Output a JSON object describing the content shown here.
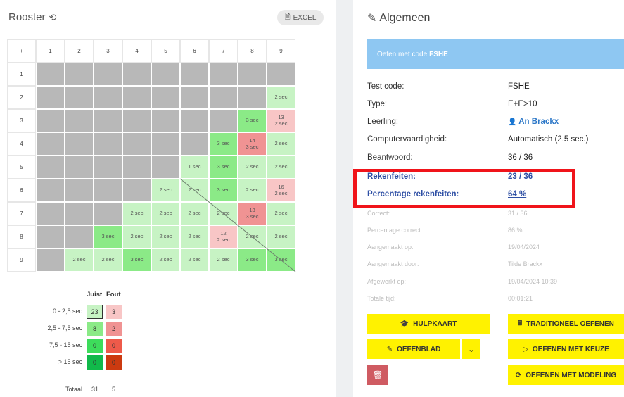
{
  "left": {
    "title": "Rooster",
    "excel_label": "EXCEL",
    "grid": {
      "corner": "+",
      "cols": [
        "1",
        "2",
        "3",
        "4",
        "5",
        "6",
        "7",
        "8",
        "9"
      ],
      "rows": [
        "1",
        "2",
        "3",
        "4",
        "5",
        "6",
        "7",
        "8",
        "9"
      ],
      "cells": [
        [
          "",
          "",
          "",
          "",
          "",
          "",
          "",
          "",
          ""
        ],
        [
          "",
          "",
          "",
          "",
          "",
          "",
          "",
          "",
          "2 sec"
        ],
        [
          "",
          "",
          "",
          "",
          "",
          "",
          "",
          "3 sec",
          "13\n2 sec"
        ],
        [
          "",
          "",
          "",
          "",
          "",
          "",
          "3 sec",
          "14\n3 sec",
          "2 sec"
        ],
        [
          "",
          "",
          "",
          "",
          "",
          "1 sec",
          "3 sec",
          "2 sec",
          "2 sec"
        ],
        [
          "",
          "",
          "",
          "",
          "2 sec",
          "2 sec",
          "3 sec",
          "2 sec",
          "16\n2 sec"
        ],
        [
          "",
          "",
          "",
          "2 sec",
          "2 sec",
          "2 sec",
          "2 sec",
          "13\n3 sec",
          "2 sec"
        ],
        [
          "",
          "",
          "3 sec",
          "2 sec",
          "2 sec",
          "2 sec",
          "12\n2 sec",
          "2 sec",
          "2 sec"
        ],
        [
          "",
          "2 sec",
          "2 sec",
          "3 sec",
          "2 sec",
          "2 sec",
          "2 sec",
          "3 sec",
          "3 sec"
        ]
      ],
      "kinds": [
        [
          "x",
          "x",
          "x",
          "x",
          "x",
          "x",
          "x",
          "x",
          "x"
        ],
        [
          "x",
          "x",
          "x",
          "x",
          "x",
          "x",
          "x",
          "x",
          "lg"
        ],
        [
          "x",
          "x",
          "x",
          "x",
          "x",
          "x",
          "x",
          "g",
          "pk"
        ],
        [
          "x",
          "x",
          "x",
          "x",
          "x",
          "x",
          "g",
          "rd",
          "lg"
        ],
        [
          "x",
          "x",
          "x",
          "x",
          "x",
          "lg",
          "g",
          "lg",
          "lg"
        ],
        [
          "x",
          "x",
          "x",
          "x",
          "lg",
          "lg",
          "g",
          "lg",
          "pk"
        ],
        [
          "x",
          "x",
          "x",
          "lg",
          "lg",
          "lg",
          "lg",
          "rd",
          "lg"
        ],
        [
          "x",
          "x",
          "g",
          "lg",
          "lg",
          "lg",
          "pk",
          "lg",
          "lg"
        ],
        [
          "x",
          "lg",
          "lg",
          "g",
          "lg",
          "lg",
          "lg",
          "g",
          "g"
        ]
      ],
      "colors": {
        "x": "#b8b8b8",
        "lg": "#c7f3c4",
        "g": "#8bea87",
        "pk": "#f8c6c6",
        "rd": "#f09393"
      }
    },
    "summary": {
      "col_juist": "Juist",
      "col_fout": "Fout",
      "rows": [
        {
          "label": "0 - 2,5 sec",
          "juist": "23",
          "fout": "3",
          "juist_color": "#c7f3c4",
          "fout_color": "#f8c6c6"
        },
        {
          "label": "2,5 - 7,5 sec",
          "juist": "8",
          "fout": "2",
          "juist_color": "#8bea87",
          "fout_color": "#f09393"
        },
        {
          "label": "7,5 - 15 sec",
          "juist": "0",
          "fout": "0",
          "juist_color": "#3ddc5b",
          "fout_color": "#ee5a4a"
        },
        {
          "label": "> 15 sec",
          "juist": "0",
          "fout": "0",
          "juist_color": "#11b94a",
          "fout_color": "#cc3a10"
        }
      ],
      "total_label": "Totaal",
      "total_juist": "31",
      "total_fout": "5"
    }
  },
  "right": {
    "title": "Algemeen",
    "banner_prefix": "Oefen met code",
    "banner_code": "FSHE",
    "info": [
      {
        "label": "Test code:",
        "value": "FSHE"
      },
      {
        "label": "Type:",
        "value": "E+E>10"
      },
      {
        "label": "Leerling:",
        "value": "An Brackx"
      },
      {
        "label": "Computervaardigheid:",
        "value": "Automatisch (2.5 sec.)"
      },
      {
        "label": "Beantwoord:",
        "value": "36 / 36"
      },
      {
        "label": "Rekenfeiten:",
        "value": "23 / 36"
      },
      {
        "label": "Percentage rekenfeiten:",
        "value": "64 %"
      },
      {
        "label": "Correct:",
        "value": "31 / 36"
      },
      {
        "label": "Percentage correct:",
        "value": "86 %"
      },
      {
        "label": "Aangemaakt op:",
        "value": "19/04/2024"
      },
      {
        "label": "Aangemaakt door:",
        "value": "Tilde Brackx"
      },
      {
        "label": "Afgewerkt op:",
        "value": "19/04/2024 10:39"
      },
      {
        "label": "Totale tijd:",
        "value": "00:01:21"
      }
    ],
    "buttons": {
      "hulpkaart": "HULPKAART",
      "traditioneel": "TRADITIONEEL OEFENEN",
      "oefenblad": "OEFENBLAD",
      "keuze": "OEFENEN MET KEUZE",
      "modeling": "OEFENEN MET MODELING"
    }
  }
}
